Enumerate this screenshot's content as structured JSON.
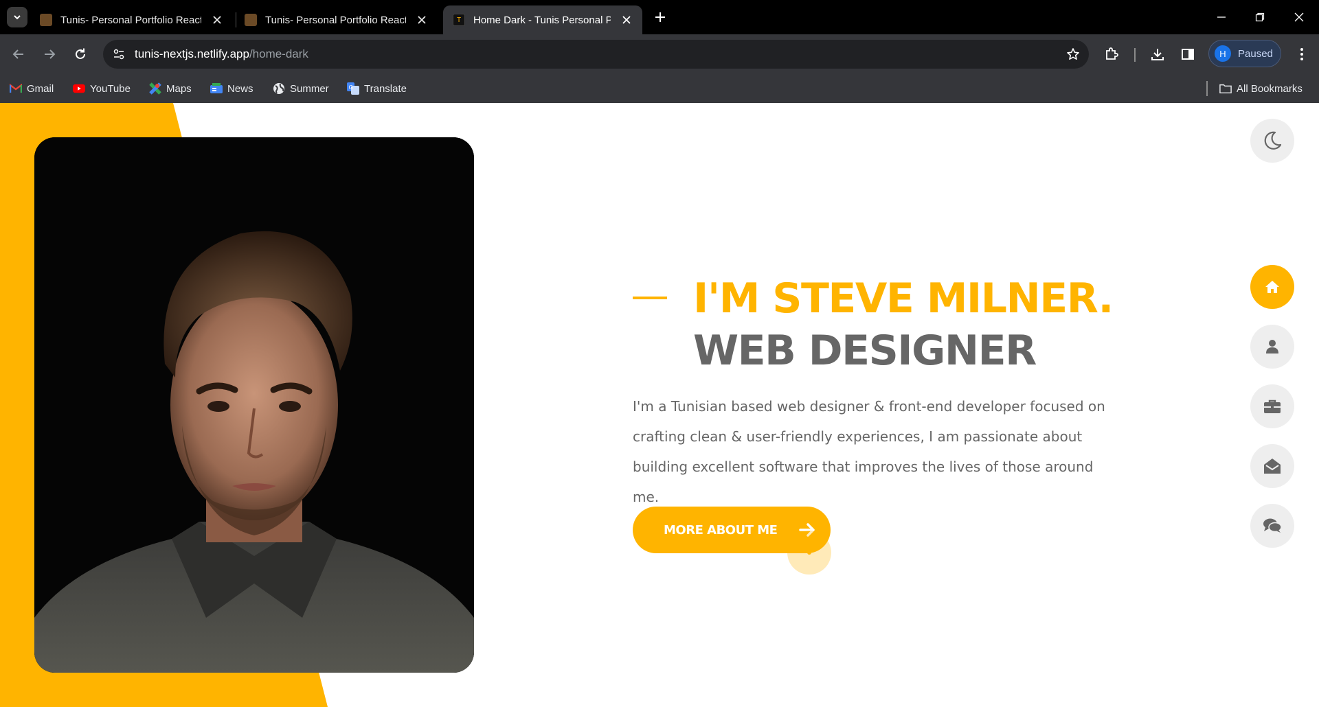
{
  "browser": {
    "tabs": [
      {
        "title": "Tunis- Personal Portfolio React",
        "active": false
      },
      {
        "title": "Tunis- Personal Portfolio React",
        "active": false
      },
      {
        "title": "Home Dark - Tunis Personal Por",
        "active": true
      }
    ],
    "address": {
      "host": "tunis-nextjs.netlify.app",
      "path": "/home-dark"
    },
    "profile": {
      "initial": "H",
      "status": "Paused"
    },
    "bookmarks": [
      {
        "label": "Gmail",
        "icon": "gmail-icon"
      },
      {
        "label": "YouTube",
        "icon": "youtube-icon"
      },
      {
        "label": "Maps",
        "icon": "maps-icon"
      },
      {
        "label": "News",
        "icon": "news-icon"
      },
      {
        "label": "Summer",
        "icon": "globe-icon"
      },
      {
        "label": "Translate",
        "icon": "translate-icon"
      }
    ],
    "all_bookmarks": "All Bookmarks"
  },
  "hero": {
    "name": "I'M STEVE MILNER.",
    "role": "WEB DESIGNER",
    "description": "I'm a Tunisian based web designer & front-end developer focused on crafting clean & user-friendly experiences, I am passionate about building excellent software that improves the lives of those around me.",
    "cta_label": "MORE ABOUT ME"
  },
  "side_nav": [
    {
      "icon": "home-icon",
      "active": true
    },
    {
      "icon": "user-icon",
      "active": false
    },
    {
      "icon": "briefcase-icon",
      "active": false
    },
    {
      "icon": "envelope-open-icon",
      "active": false
    },
    {
      "icon": "comments-icon",
      "active": false
    }
  ],
  "colors": {
    "accent": "#ffb400",
    "heading_gray": "#666666",
    "chrome_dark": "#35363a"
  }
}
